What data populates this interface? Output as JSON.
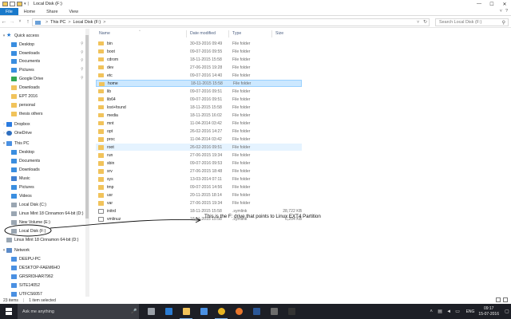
{
  "window": {
    "title": "Local Disk (F:)",
    "controls": {
      "minimize": "—",
      "maximize": "☐",
      "close": "✕"
    }
  },
  "ribbon": {
    "tabs": [
      "File",
      "Home",
      "Share",
      "View"
    ],
    "expand_icon": "˅",
    "help_icon": "?"
  },
  "address": {
    "back": "←",
    "forward": "→",
    "recent": "˅",
    "up": "↑",
    "crumbs": [
      "This PC",
      "Local Disk (F:)"
    ],
    "separator": ">",
    "search_placeholder": "Search Local Disk (F:)"
  },
  "nav": {
    "items": [
      {
        "label": "Quick access",
        "icon": "star-icon",
        "pinned": false
      },
      {
        "label": "Desktop",
        "icon": "desktop-icon",
        "pinned": true
      },
      {
        "label": "Downloads",
        "icon": "downloads-icon",
        "pinned": true
      },
      {
        "label": "Documents",
        "icon": "documents-icon",
        "pinned": true
      },
      {
        "label": "Pictures",
        "icon": "pictures-icon",
        "pinned": true
      },
      {
        "label": "Google Drive",
        "icon": "google-drive-icon",
        "pinned": true
      },
      {
        "label": "Downloads",
        "icon": "folder-icon",
        "pinned": false
      },
      {
        "label": "EPT 2016",
        "icon": "folder-icon",
        "pinned": false
      },
      {
        "label": "personal",
        "icon": "folder-icon",
        "pinned": false
      },
      {
        "label": "thesis others",
        "icon": "folder-icon",
        "pinned": false
      },
      {
        "label": "Dropbox",
        "icon": "dropbox-icon",
        "pinned": false
      },
      {
        "label": "OneDrive",
        "icon": "onedrive-icon",
        "pinned": false
      },
      {
        "label": "This PC",
        "icon": "pc-icon",
        "pinned": false
      },
      {
        "label": "Desktop",
        "icon": "desktop-icon",
        "pinned": false
      },
      {
        "label": "Documents",
        "icon": "documents-icon",
        "pinned": false
      },
      {
        "label": "Downloads",
        "icon": "downloads-icon",
        "pinned": false
      },
      {
        "label": "Music",
        "icon": "music-icon",
        "pinned": false
      },
      {
        "label": "Pictures",
        "icon": "pictures-icon",
        "pinned": false
      },
      {
        "label": "Videos",
        "icon": "videos-icon",
        "pinned": false
      },
      {
        "label": "Local Disk (C:)",
        "icon": "drive-icon",
        "pinned": false
      },
      {
        "label": "Linux Mint 18 Cinnamon 64-bit (D:)",
        "icon": "drive-icon",
        "pinned": false
      },
      {
        "label": "New Volume (E:)",
        "icon": "drive-icon",
        "pinned": false
      },
      {
        "label": "Local Disk (F:)",
        "icon": "drive-icon",
        "pinned": false
      },
      {
        "label": "Linux Mint 18 Cinnamon 64-bit (D:)",
        "icon": "drive-icon",
        "pinned": false
      },
      {
        "label": "Network",
        "icon": "network-icon",
        "pinned": false
      },
      {
        "label": "DEEPU-PC",
        "icon": "computer-icon",
        "pinned": false
      },
      {
        "label": "DESKTOP-FAEM6HO",
        "icon": "computer-icon",
        "pinned": false
      },
      {
        "label": "GRSRIDHAR7962",
        "icon": "computer-icon",
        "pinned": false
      },
      {
        "label": "SITE14052",
        "icon": "computer-icon",
        "pinned": false
      },
      {
        "label": "UTFCS6057",
        "icon": "computer-icon",
        "pinned": false
      }
    ]
  },
  "columns": {
    "name": "Name",
    "date": "Date modified",
    "type": "Type",
    "size": "Size",
    "sort_indicator": "^"
  },
  "files": [
    {
      "name": "bin",
      "date": "30-03-2016 09:49",
      "type": "File folder",
      "size": "",
      "kind": "folder"
    },
    {
      "name": "boot",
      "date": "09-07-2016 09:55",
      "type": "File folder",
      "size": "",
      "kind": "folder"
    },
    {
      "name": "cdrom",
      "date": "18-11-2015 15:58",
      "type": "File folder",
      "size": "",
      "kind": "folder"
    },
    {
      "name": "dev",
      "date": "27-06-2015 19:28",
      "type": "File folder",
      "size": "",
      "kind": "folder"
    },
    {
      "name": "etc",
      "date": "09-07-2016 14:40",
      "type": "File folder",
      "size": "",
      "kind": "folder"
    },
    {
      "name": "home",
      "date": "18-11-2015 15:58",
      "type": "File folder",
      "size": "",
      "kind": "folder",
      "state": "selected"
    },
    {
      "name": "lib",
      "date": "09-07-2016 09:51",
      "type": "File folder",
      "size": "",
      "kind": "folder"
    },
    {
      "name": "lib64",
      "date": "09-07-2016 09:51",
      "type": "File folder",
      "size": "",
      "kind": "folder"
    },
    {
      "name": "lost+found",
      "date": "18-11-2015 15:58",
      "type": "File folder",
      "size": "",
      "kind": "folder"
    },
    {
      "name": "media",
      "date": "18-11-2015 16:02",
      "type": "File folder",
      "size": "",
      "kind": "folder"
    },
    {
      "name": "mnt",
      "date": "11-04-2014 03:42",
      "type": "File folder",
      "size": "",
      "kind": "folder"
    },
    {
      "name": "opt",
      "date": "26-02-2016 14:27",
      "type": "File folder",
      "size": "",
      "kind": "folder"
    },
    {
      "name": "proc",
      "date": "11-04-2014 03:42",
      "type": "File folder",
      "size": "",
      "kind": "folder"
    },
    {
      "name": "root",
      "date": "26-02-2016 09:51",
      "type": "File folder",
      "size": "",
      "kind": "folder",
      "state": "hover"
    },
    {
      "name": "run",
      "date": "27-06-2015 19:34",
      "type": "File folder",
      "size": "",
      "kind": "folder"
    },
    {
      "name": "sbin",
      "date": "09-07-2016 09:53",
      "type": "File folder",
      "size": "",
      "kind": "folder"
    },
    {
      "name": "srv",
      "date": "27-06-2015 18:48",
      "type": "File folder",
      "size": "",
      "kind": "folder"
    },
    {
      "name": "sys",
      "date": "13-03-2014 07:11",
      "type": "File folder",
      "size": "",
      "kind": "folder"
    },
    {
      "name": "tmp",
      "date": "09-07-2016 14:56",
      "type": "File folder",
      "size": "",
      "kind": "folder"
    },
    {
      "name": "usr",
      "date": "20-11-2015 18:14",
      "type": "File folder",
      "size": "",
      "kind": "folder"
    },
    {
      "name": "var",
      "date": "27-06-2015 19:34",
      "type": "File folder",
      "size": "",
      "kind": "folder"
    },
    {
      "name": "initrd",
      "date": "18-11-2015 15:58",
      "type": ".symlink",
      "size": "28,722 KB",
      "kind": "file"
    },
    {
      "name": "vmlinuz",
      "date": "18-11-2015 15:58",
      "type": ".symlink",
      "size": "6,204 KB",
      "kind": "file"
    }
  ],
  "annotation": {
    "text": "This is the F: drive that points to Linux EXT4 Partition"
  },
  "status": {
    "items": "23 items",
    "selected": "1 item selected"
  },
  "taskbar": {
    "search_placeholder": "Ask me anything",
    "apps": [
      "task-view-icon",
      "edge-icon",
      "file-explorer-icon",
      "store-icon",
      "chrome-icon",
      "firefox-icon",
      "word-icon",
      "app-icon",
      "terminal-icon"
    ],
    "lang": "ENG",
    "time": "09:17",
    "date": "15-07-2016"
  },
  "colors": {
    "accent": "#1979ca",
    "selection": "#cce8ff",
    "folder": "#f1c35b",
    "taskbar": "#1d1f26"
  }
}
